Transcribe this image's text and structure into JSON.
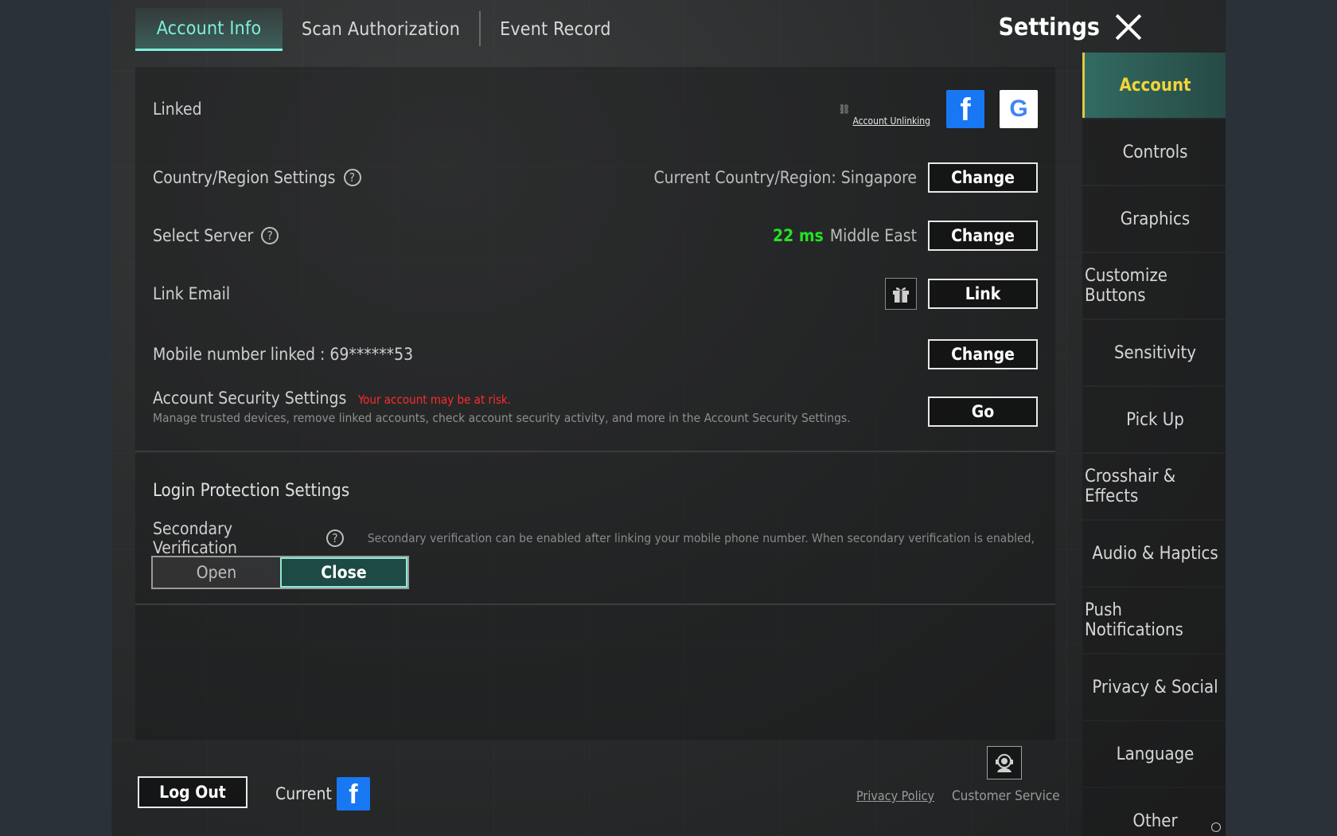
{
  "tabs": [
    {
      "label": "Account Info"
    },
    {
      "label": "Scan Authorization"
    },
    {
      "label": "Event Record"
    }
  ],
  "header": {
    "title": "Settings"
  },
  "linked": {
    "label": "Linked",
    "unlink_label": "Account Unlinking"
  },
  "country": {
    "label": "Country/Region Settings",
    "value": "Current Country/Region: Singapore",
    "button": "Change"
  },
  "server": {
    "label": "Select Server",
    "ping": "22 ms",
    "region": "Middle East",
    "button": "Change"
  },
  "email": {
    "label": "Link Email",
    "button": "Link"
  },
  "mobile": {
    "label": "Mobile number linked : 69******53",
    "button": "Change"
  },
  "security": {
    "label": "Account Security Settings",
    "warning": "Your account may be at risk.",
    "description": "Manage trusted devices, remove linked accounts, check account security activity, and more in the Account Security Settings.",
    "button": "Go"
  },
  "login_protection": {
    "title": "Login Protection Settings",
    "secondary_label": "Secondary Verification",
    "secondary_desc": "Secondary verification can be enabled after linking your mobile phone number. When secondary verification is enabled, nc",
    "open_label": "Open",
    "close_label": "Close"
  },
  "bottom": {
    "logout": "Log Out",
    "current": "Current",
    "privacy": "Privacy Policy",
    "customer_service": "Customer Service"
  },
  "side_nav": [
    {
      "label": "Account"
    },
    {
      "label": "Controls"
    },
    {
      "label": "Graphics"
    },
    {
      "label": "Customize Buttons"
    },
    {
      "label": "Sensitivity"
    },
    {
      "label": "Pick Up"
    },
    {
      "label": "Crosshair & Effects"
    },
    {
      "label": "Audio & Haptics"
    },
    {
      "label": "Push Notifications"
    },
    {
      "label": "Privacy & Social"
    },
    {
      "label": "Language"
    },
    {
      "label": "Other"
    }
  ],
  "colors": {
    "accent": "#7ff0dc",
    "active_nav": "#f2d43a",
    "ping_green": "#23e223",
    "warning_red": "#ff2a2a",
    "facebook": "#1877f2"
  }
}
